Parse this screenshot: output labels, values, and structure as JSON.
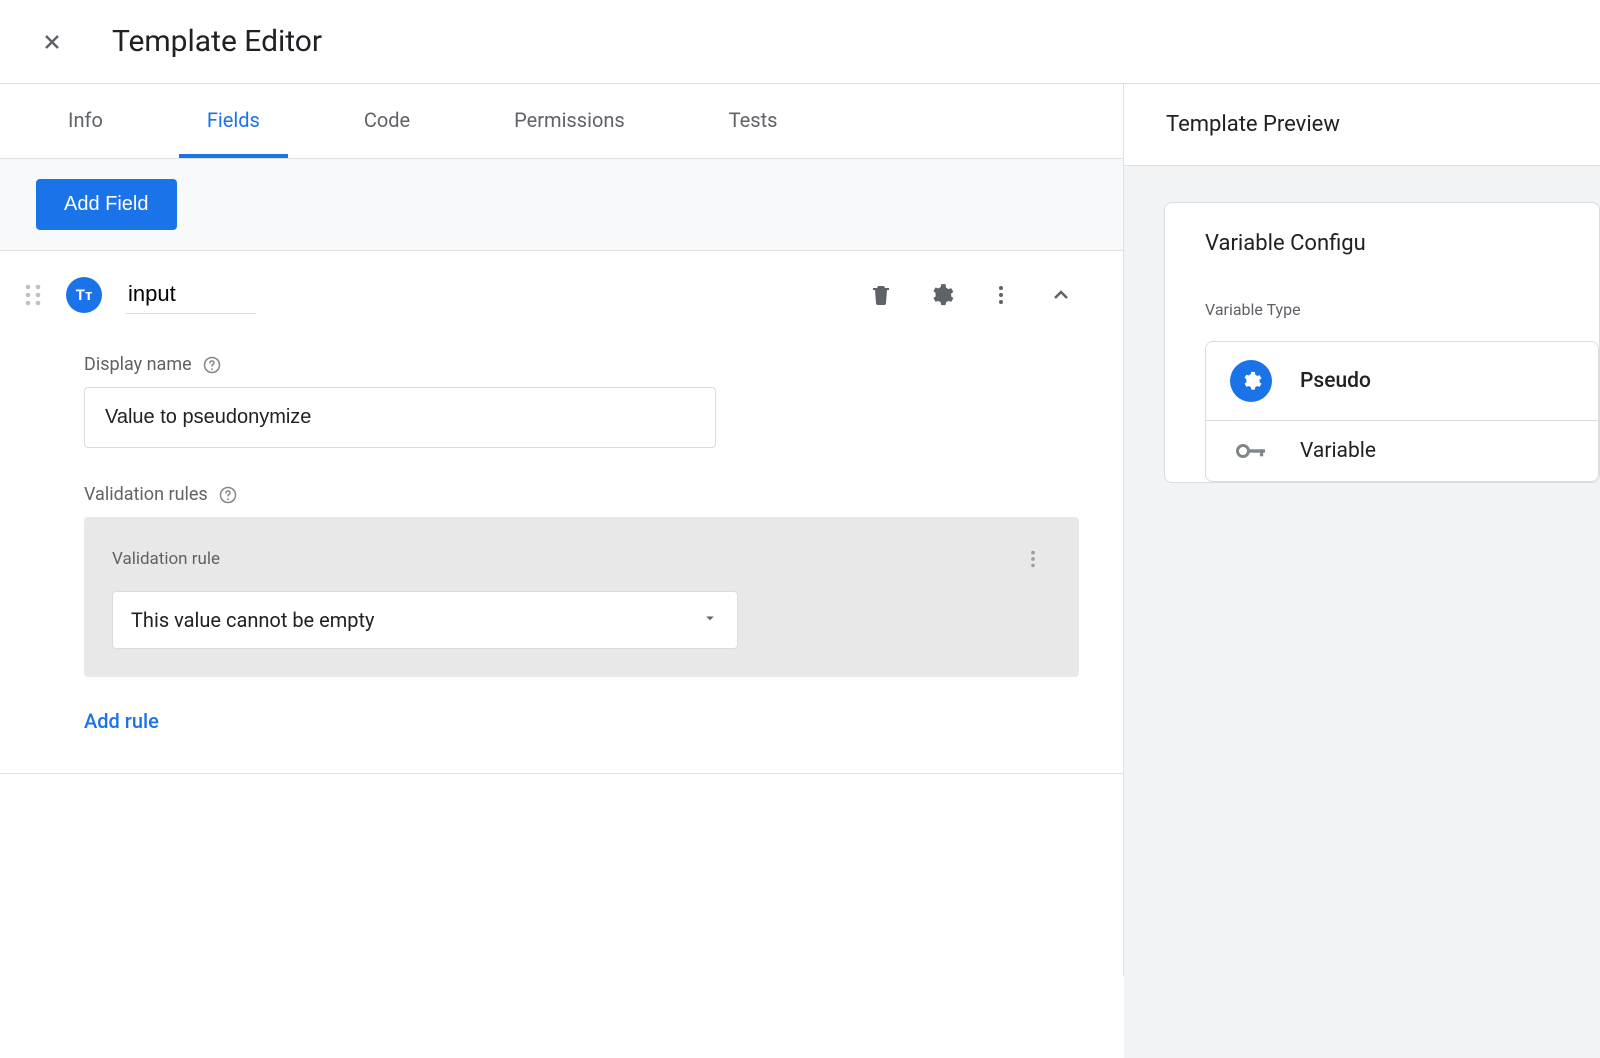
{
  "header": {
    "title": "Template Editor"
  },
  "tabs": [
    {
      "label": "Info",
      "active": false
    },
    {
      "label": "Fields",
      "active": true
    },
    {
      "label": "Code",
      "active": false
    },
    {
      "label": "Permissions",
      "active": false
    },
    {
      "label": "Tests",
      "active": false
    }
  ],
  "buttons": {
    "add_field": "Add Field",
    "add_rule": "Add rule"
  },
  "field": {
    "badge_text": "Tᴛ",
    "name": "input",
    "display_name_label": "Display name",
    "display_name_value": "Value to pseudonymize",
    "validation_rules_label": "Validation rules",
    "validation_rule_card_label": "Validation rule",
    "validation_rule_selected": "This value cannot be empty"
  },
  "preview": {
    "title": "Template Preview",
    "card_title": "Variable Configu",
    "variable_type_label": "Variable Type",
    "rows": [
      {
        "label": "Pseudo"
      },
      {
        "label": "Variable"
      }
    ]
  }
}
